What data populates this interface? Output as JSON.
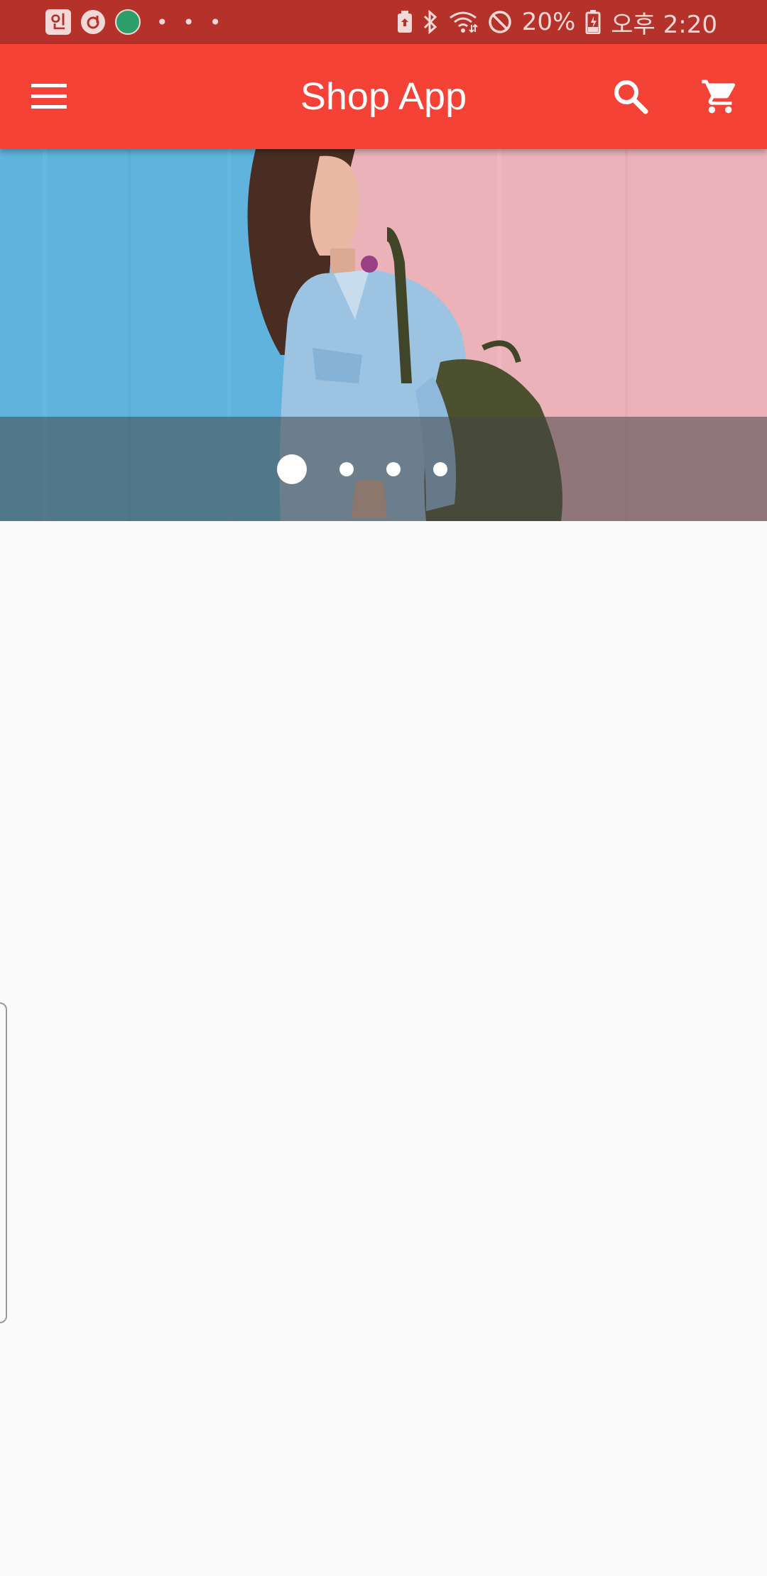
{
  "status_bar": {
    "app_icon_1": "인",
    "more_dots": "• • •",
    "battery_percent": "20%",
    "time": "오후 2:20",
    "icons": [
      "notification-app-icon",
      "refresh-app-icon",
      "dev-app-icon",
      "battery-saver-icon",
      "bluetooth-icon",
      "wifi-icon",
      "do-not-disturb-icon",
      "battery-icon"
    ]
  },
  "app_bar": {
    "title": "Shop App",
    "background_color": "#f44336",
    "icons": [
      "menu-icon",
      "search-icon",
      "cart-icon"
    ]
  },
  "banner": {
    "slide_count": 4,
    "active_index": 0,
    "image_description_icon": "banner-photo"
  },
  "colors": {
    "status_bar": "#b5322b",
    "page_background": "#fafafa"
  }
}
